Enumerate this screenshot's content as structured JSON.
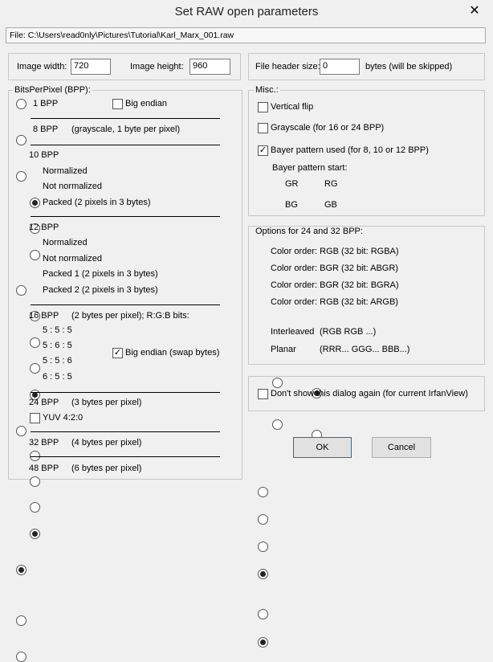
{
  "window": {
    "title": "Set RAW open parameters",
    "close_glyph": "✕"
  },
  "file_line": "File: C:\\Users\\read0nly\\Pictures\\Tutorial\\Karl_Marx_001.raw",
  "dimensions": {
    "width_label": "Image width:",
    "width_value": "720",
    "height_label": "Image height:",
    "height_value": "960"
  },
  "header": {
    "label": "File header size:",
    "value": "0",
    "suffix": "bytes (will be skipped)"
  },
  "bpp": {
    "legend": "BitsPerPixel (BPP):",
    "opt1": {
      "label": "1 BPP",
      "big_endian": "Big endian"
    },
    "opt8": {
      "label": "8 BPP",
      "desc": "(grayscale, 1 byte per pixel)"
    },
    "opt10": {
      "label": "10 BPP",
      "normalized": "Normalized",
      "not_normalized": "Not normalized",
      "packed": "Packed (2 pixels in 3 bytes)"
    },
    "opt12": {
      "label": "12 BPP",
      "normalized": "Normalized",
      "not_normalized": "Not normalized",
      "packed1": "Packed 1 (2 pixels in 3 bytes)",
      "packed2": "Packed 2 (2 pixels in 3 bytes)"
    },
    "opt16": {
      "label": "16 BPP",
      "desc": "(2 bytes per pixel); R:G:B bits:",
      "b555": "5 : 5 : 5",
      "b565": "5 : 6 : 5",
      "b556": "5 : 5 : 6",
      "b655": "6 : 5 : 5",
      "big_endian": "Big endian (swap bytes)"
    },
    "opt24": {
      "label": "24 BPP",
      "desc": "(3 bytes per pixel)",
      "yuv": "YUV 4:2:0"
    },
    "opt32": {
      "label": "32 BPP",
      "desc": "(4 bytes per pixel)"
    },
    "opt48": {
      "label": "48 BPP",
      "desc": "(6 bytes per pixel)"
    }
  },
  "misc": {
    "legend": "Misc.:",
    "vertical_flip": "Vertical flip",
    "grayscale": "Grayscale (for 16 or 24 BPP)",
    "bayer_used": "Bayer pattern used (for 8, 10 or 12 BPP)",
    "bayer_start": "Bayer pattern start:",
    "gr": "GR",
    "rg": "RG",
    "bg": "BG",
    "gb": "GB"
  },
  "options2432": {
    "legend": "Options for 24 and 32 BPP:",
    "rgba": "Color order: RGB (32 bit: RGBA)",
    "abgr": "Color order: BGR (32 bit: ABGR)",
    "bgra": "Color order: BGR (32 bit: BGRA)",
    "argb": "Color order: RGB (32 bit: ARGB)",
    "interleaved": "Interleaved",
    "interleaved_desc": "(RGB RGB ...)",
    "planar": "Planar",
    "planar_desc": "(RRR... GGG... BBB...)"
  },
  "dont_show": "Don't show this dialog again (for current IrfanView)",
  "buttons": {
    "ok": "OK",
    "cancel": "Cancel"
  },
  "checkmark": "✓"
}
